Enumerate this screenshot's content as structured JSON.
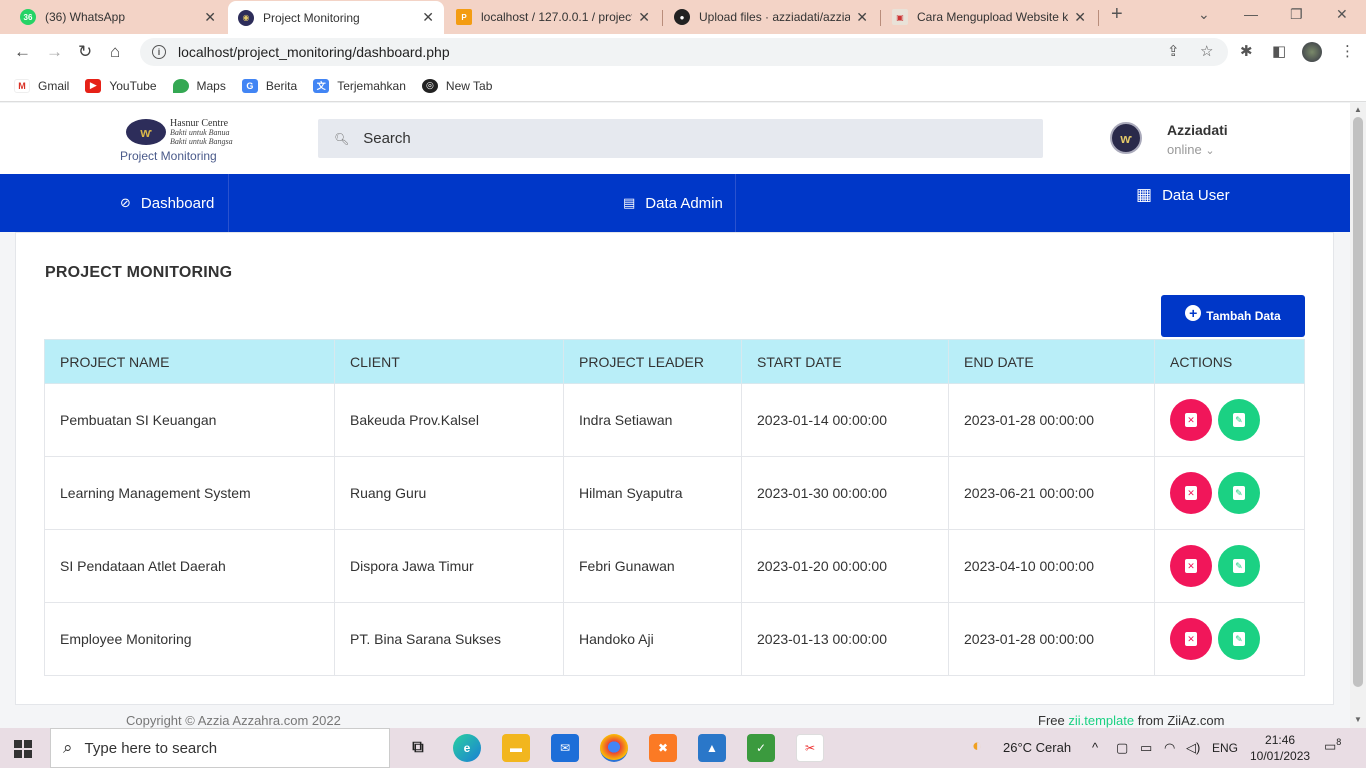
{
  "browser": {
    "tabs": [
      {
        "title": "(36) WhatsApp",
        "badge": "36"
      },
      {
        "title": "Project Monitoring"
      },
      {
        "title": "localhost / 127.0.0.1 / project"
      },
      {
        "title": "Upload files · azziadati/azziad"
      },
      {
        "title": "Cara Mengupload Website ke"
      }
    ],
    "url": "localhost/project_monitoring/dashboard.php",
    "bookmarks": [
      "Gmail",
      "YouTube",
      "Maps",
      "Berita",
      "Terjemahkan",
      "New Tab"
    ]
  },
  "header": {
    "logo_line1": "Hasnur Centre",
    "logo_line2": "Bakti untuk Banua",
    "logo_line3": "Bakti untuk Bangsa",
    "brand_sub": "Project Monitoring",
    "search_placeholder": "Search",
    "user_name": "Azziadati",
    "user_status": "online"
  },
  "nav": {
    "items": [
      {
        "label": "Dashboard",
        "icon": "dashboard-icon"
      },
      {
        "label": "Data Admin",
        "icon": "clipboard-icon"
      },
      {
        "label": "Data User",
        "icon": "contact-card-icon"
      }
    ]
  },
  "main": {
    "title": "PROJECT MONITORING",
    "add_button": "Tambah Data",
    "columns": [
      "PROJECT NAME",
      "CLIENT",
      "PROJECT LEADER",
      "START DATE",
      "END DATE",
      "ACTIONS"
    ],
    "rows": [
      {
        "name": "Pembuatan SI Keuangan",
        "client": "Bakeuda Prov.Kalsel",
        "leader": "Indra Setiawan",
        "start": "2023-01-14 00:00:00",
        "end": "2023-01-28 00:00:00"
      },
      {
        "name": "Learning Management System",
        "client": "Ruang Guru",
        "leader": "Hilman Syaputra",
        "start": "2023-01-30 00:00:00",
        "end": "2023-06-21 00:00:00"
      },
      {
        "name": "SI Pendataan Atlet Daerah",
        "client": "Dispora Jawa Timur",
        "leader": "Febri Gunawan",
        "start": "2023-01-20 00:00:00",
        "end": "2023-04-10 00:00:00"
      },
      {
        "name": "Employee Monitoring",
        "client": "PT. Bina Sarana Sukses",
        "leader": "Handoko Aji",
        "start": "2023-01-13 00:00:00",
        "end": "2023-01-28 00:00:00"
      }
    ]
  },
  "footer": {
    "copyright": "Copyright © Azzia Azzahra.com 2022",
    "free_prefix": "Free",
    "template_link": "zii.template",
    "from_text": "from ZiiAz.com"
  },
  "taskbar": {
    "search_placeholder": "Type here to search",
    "weather": "26°C  Cerah",
    "lang": "ENG",
    "time": "21:46",
    "date": "10/01/2023",
    "notifications": "8"
  },
  "colors": {
    "nav_bg": "#0037c8",
    "header_row_bg": "#b9eef8",
    "delete_btn": "#f1165a",
    "edit_btn": "#1bd183"
  }
}
